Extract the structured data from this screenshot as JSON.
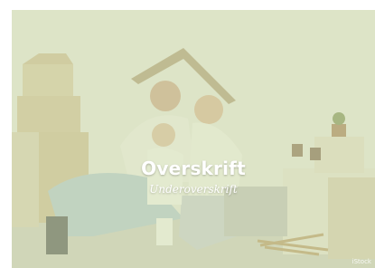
{
  "hero": {
    "title": "Overskrift",
    "subtitle": "Underoverskrift",
    "image_credit": "iStock",
    "overlay_color": "#d6e2b4"
  }
}
